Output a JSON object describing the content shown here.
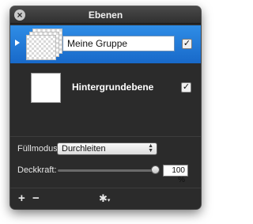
{
  "window": {
    "title": "Ebenen"
  },
  "layers": [
    {
      "name": "Meine Gruppe",
      "visible": true,
      "selected": true,
      "type": "group"
    },
    {
      "name": "Hintergrundebene",
      "visible": true,
      "selected": false,
      "type": "layer"
    }
  ],
  "controls": {
    "blend_label": "Füllmodus:",
    "blend_value": "Durchleiten",
    "opacity_label": "Deckkraft:",
    "opacity_value": "100 %",
    "opacity_level": 1.0
  },
  "toolbar": {
    "add_symbol": "+",
    "remove_symbol": "−",
    "settings_icon": "gear-icon"
  },
  "colors": {
    "selection": "#2a7fdc",
    "panel": "#2b2b2b"
  }
}
